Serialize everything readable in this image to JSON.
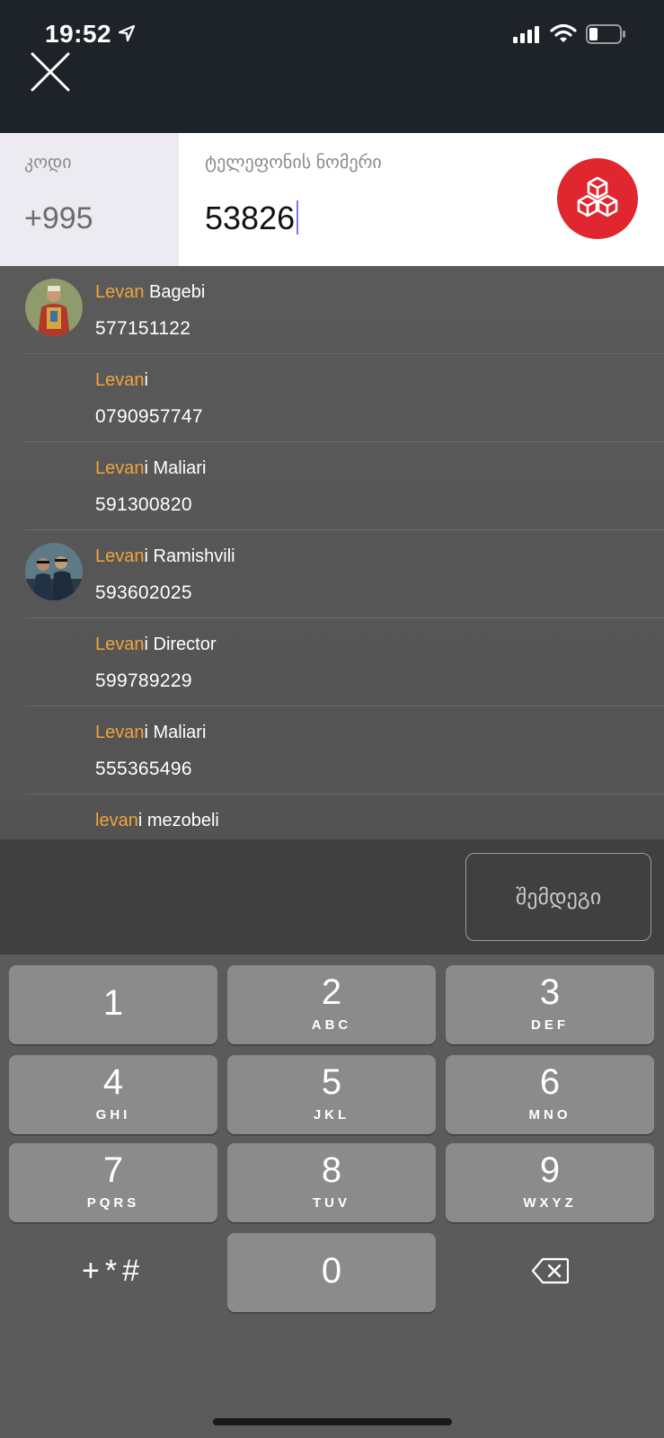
{
  "status_bar": {
    "time": "19:52"
  },
  "input": {
    "code_label": "კოდი",
    "code_value": "+995",
    "phone_label": "ტელეფონის ნომერი",
    "phone_value": "53826"
  },
  "contacts": [
    {
      "highlight": "Levan",
      "rest": " Bagebi",
      "phone": "577151122",
      "avatar": "photo"
    },
    {
      "highlight": "Levan",
      "rest": "i",
      "phone": "0790957747",
      "avatar": "none"
    },
    {
      "highlight": "Levan",
      "rest": "i Maliari",
      "phone": "591300820",
      "avatar": "none"
    },
    {
      "highlight": "Levan",
      "rest": "i Ramishvili",
      "phone": "593602025",
      "avatar": "photo"
    },
    {
      "highlight": "Levan",
      "rest": "i Director",
      "phone": "599789229",
      "avatar": "none"
    },
    {
      "highlight": "Levan",
      "rest": "i Maliari",
      "phone": "555365496",
      "avatar": "none"
    },
    {
      "highlight": "levan",
      "rest": "i mezobeli",
      "phone": "",
      "avatar": "none"
    }
  ],
  "next_button": "შემდეგი",
  "keypad": {
    "keys": [
      {
        "num": "1",
        "letters": ""
      },
      {
        "num": "2",
        "letters": "ABC"
      },
      {
        "num": "3",
        "letters": "DEF"
      },
      {
        "num": "4",
        "letters": "GHI"
      },
      {
        "num": "5",
        "letters": "JKL"
      },
      {
        "num": "6",
        "letters": "MNO"
      },
      {
        "num": "7",
        "letters": "PQRS"
      },
      {
        "num": "8",
        "letters": "TUV"
      },
      {
        "num": "9",
        "letters": "WXYZ"
      },
      {
        "num": "0",
        "letters": ""
      }
    ],
    "symbols": "+*#"
  },
  "colors": {
    "highlight": "#f0a43a",
    "brand": "#e0262e",
    "header": "#1e2329"
  },
  "icons": [
    "close-icon",
    "location-arrow-icon",
    "signal-icon",
    "wifi-icon",
    "battery-icon",
    "brand-cubes-icon",
    "backspace-icon"
  ]
}
